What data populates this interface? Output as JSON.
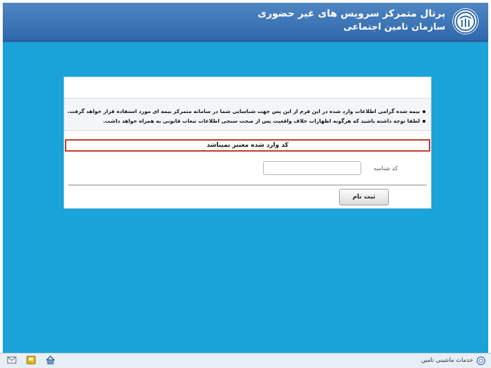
{
  "header": {
    "title_line1": "پرتال متمرکز سرویس های غیر حضوری",
    "title_line2": "سازمان تامین اجتماعی",
    "logo_icon": "tamin-logo-icon"
  },
  "notice": {
    "line1": "بیمه شده گرامی اطلاعات وارد شده در این فرم از این پس جهت شناسایی شما در سامانه متمرکز بیمه ای مورد استفاده قرار خواهد گرفت.",
    "line2": "لطفا توجه داشته باشید که هرگونه اظهارات خلاف واقعیت پس از صحت سنجی اطلاعات تبعات قانونی به همراه خواهد داشت."
  },
  "error_message": "کد وارد شده معتبر نمیباشد",
  "form": {
    "code_label": "کد شناسه",
    "code_value": "",
    "submit_label": "ثبت نام"
  },
  "footer": {
    "text": "خدمات ماشینی تامین",
    "icons": [
      "mail-icon",
      "save-icon",
      "home-icon",
      "tamin-small-logo-icon"
    ]
  },
  "colors": {
    "background": "#1aa3d8",
    "header": "#2f68ad",
    "error_border": "#c0392b"
  }
}
